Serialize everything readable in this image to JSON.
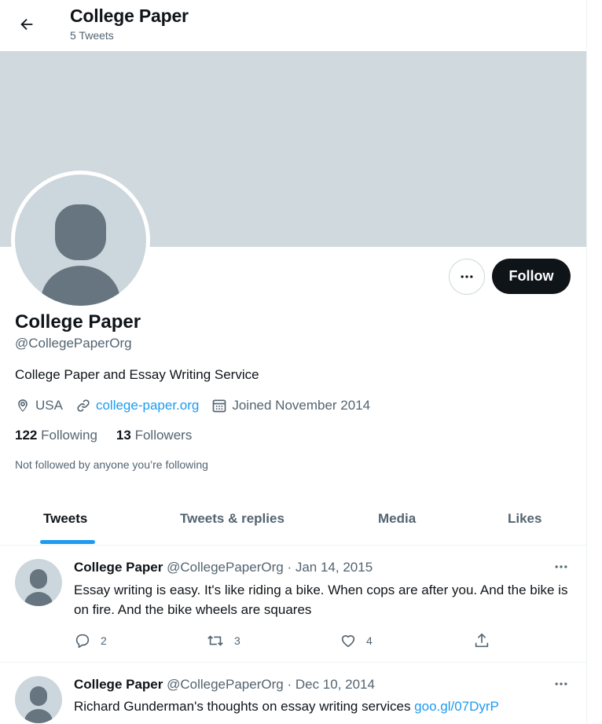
{
  "header": {
    "title": "College Paper",
    "subtitle": "5 Tweets"
  },
  "profile": {
    "name": "College Paper",
    "handle": "@CollegePaperOrg",
    "bio": "College Paper and Essay Writing Service",
    "location": "USA",
    "website": "college-paper.org",
    "joined": "Joined November 2014",
    "following_count": "122",
    "following_label": "Following",
    "followers_count": "13",
    "followers_label": "Followers",
    "note": "Not followed by anyone you’re following",
    "follow_label": "Follow"
  },
  "tabs": [
    {
      "label": "Tweets",
      "active": true
    },
    {
      "label": "Tweets & replies",
      "active": false
    },
    {
      "label": "Media",
      "active": false
    },
    {
      "label": "Likes",
      "active": false
    }
  ],
  "tweets": [
    {
      "name": "College Paper",
      "handle": "@CollegePaperOrg",
      "date": "· Jan 14, 2015",
      "text": "Essay writing is easy. It's like riding a bike. When cops are after you. And the bike is on fire. And the bike wheels are squares",
      "replies": "2",
      "retweets": "3",
      "likes": "4"
    },
    {
      "name": "College Paper",
      "handle": "@CollegePaperOrg",
      "date": "· Dec 10, 2014",
      "text": "Richard Gunderman's thoughts on essay writing services ",
      "link": "goo.gl/07DyrP"
    }
  ],
  "colors": {
    "accent": "#1d9bf0",
    "banner": "#cfd9de",
    "text_secondary": "#536471",
    "follow_button": "#0f1419"
  },
  "icons": {
    "back": "arrow-left-icon",
    "more": "more-horizontal-icon",
    "location": "location-pin-icon",
    "link": "link-icon",
    "calendar": "calendar-icon",
    "reply": "reply-icon",
    "retweet": "retweet-icon",
    "like": "heart-icon",
    "share": "share-icon"
  }
}
